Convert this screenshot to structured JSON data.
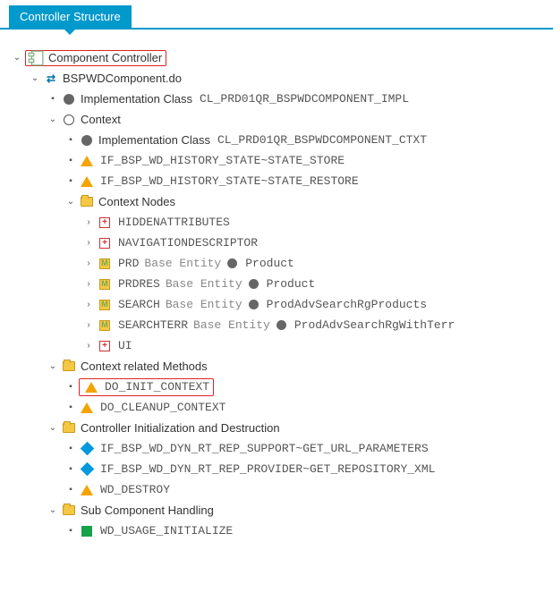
{
  "tab": {
    "label": "Controller Structure"
  },
  "root": {
    "label": "Component Controller",
    "do": {
      "label": "BSPWDComponent.do",
      "impl": {
        "label": "Implementation Class",
        "class": "CL_PRD01QR_BSPWDCOMPONENT_IMPL"
      },
      "context": {
        "label": "Context",
        "impl": {
          "label": "Implementation Class",
          "class": "CL_PRD01QR_BSPWDCOMPONENT_CTXT"
        },
        "methods": [
          "IF_BSP_WD_HISTORY_STATE~STATE_STORE",
          "IF_BSP_WD_HISTORY_STATE~STATE_RESTORE"
        ],
        "nodes": {
          "label": "Context Nodes",
          "items": [
            {
              "type": "plus",
              "name": "HIDDENATTRIBUTES"
            },
            {
              "type": "plus",
              "name": "NAVIGATIONDESCRIPTOR"
            },
            {
              "type": "m",
              "name": "PRD",
              "base_label": "Base Entity",
              "entity": "Product"
            },
            {
              "type": "m",
              "name": "PRDRES",
              "base_label": "Base Entity",
              "entity": "Product"
            },
            {
              "type": "m",
              "name": "SEARCH",
              "base_label": "Base Entity",
              "entity": "ProdAdvSearchRgProducts"
            },
            {
              "type": "m",
              "name": "SEARCHTERR",
              "base_label": "Base Entity",
              "entity": "ProdAdvSearchRgWithTerr"
            },
            {
              "type": "plus",
              "name": "UI"
            }
          ]
        }
      },
      "ctxMethods": {
        "label": "Context related Methods",
        "items": [
          "DO_INIT_CONTEXT",
          "DO_CLEANUP_CONTEXT"
        ]
      },
      "initDestroy": {
        "label": "Controller Initialization and Destruction",
        "items": [
          {
            "icon": "diamond",
            "name": "IF_BSP_WD_DYN_RT_REP_SUPPORT~GET_URL_PARAMETERS"
          },
          {
            "icon": "diamond",
            "name": "IF_BSP_WD_DYN_RT_REP_PROVIDER~GET_REPOSITORY_XML"
          },
          {
            "icon": "tri",
            "name": "WD_DESTROY"
          }
        ]
      },
      "subComp": {
        "label": "Sub Component Handling",
        "items": [
          {
            "icon": "square",
            "name": "WD_USAGE_INITIALIZE"
          }
        ]
      }
    }
  }
}
